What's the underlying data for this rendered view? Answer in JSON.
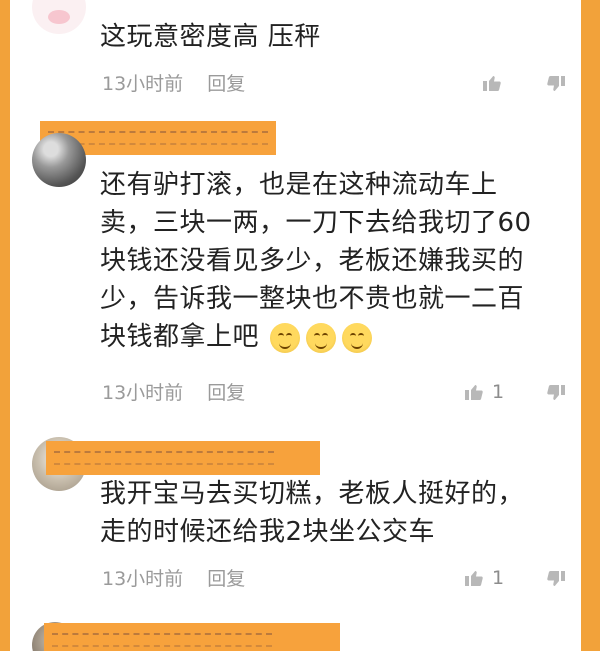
{
  "comments": [
    {
      "text_lines": [
        "这玩意密度高 压秤"
      ],
      "time": "13小时前",
      "reply": "回复",
      "likes": ""
    },
    {
      "text_lines": [
        "还有驴打滚，也是在这种流动车上",
        "卖，三块一两，一刀下去给我切了60",
        "块钱还没看见多少，老板还嫌我买的",
        "少，告诉我一整块也不贵也就一二百",
        "块钱都拿上吧"
      ],
      "time": "13小时前",
      "reply": "回复",
      "likes": "1"
    },
    {
      "text_lines": [
        "我开宝马去买切糕，老板人挺好的，",
        "走的时候还给我2块坐公交车"
      ],
      "time": "13小时前",
      "reply": "回复",
      "likes": "1"
    }
  ],
  "icons": {
    "like": "thumbs-up-icon",
    "dislike": "thumbs-down-icon"
  },
  "colors": {
    "accent": "#f2a23a"
  }
}
